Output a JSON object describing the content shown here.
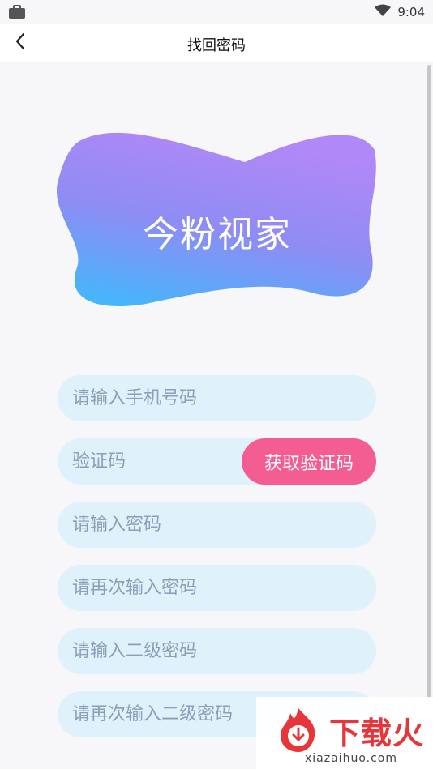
{
  "status": {
    "time": "9:04"
  },
  "header": {
    "title": "找回密码"
  },
  "logo": {
    "text": "今粉视家"
  },
  "form": {
    "phone_placeholder": "请输入手机号码",
    "code_placeholder": "验证码",
    "get_code_label": "获取验证码",
    "password_placeholder": "请输入密码",
    "password_confirm_placeholder": "请再次输入密码",
    "second_password_placeholder": "请输入二级密码",
    "second_password_confirm_placeholder": "请再次输入二级密码"
  },
  "watermark": {
    "cn": "下载火",
    "en": "xiazaihuo.com"
  },
  "colors": {
    "accent_pink": "#f45d91",
    "field_bg": "#dff1fb",
    "logo_purple": "#b088f7",
    "logo_blue": "#47b5fb"
  }
}
